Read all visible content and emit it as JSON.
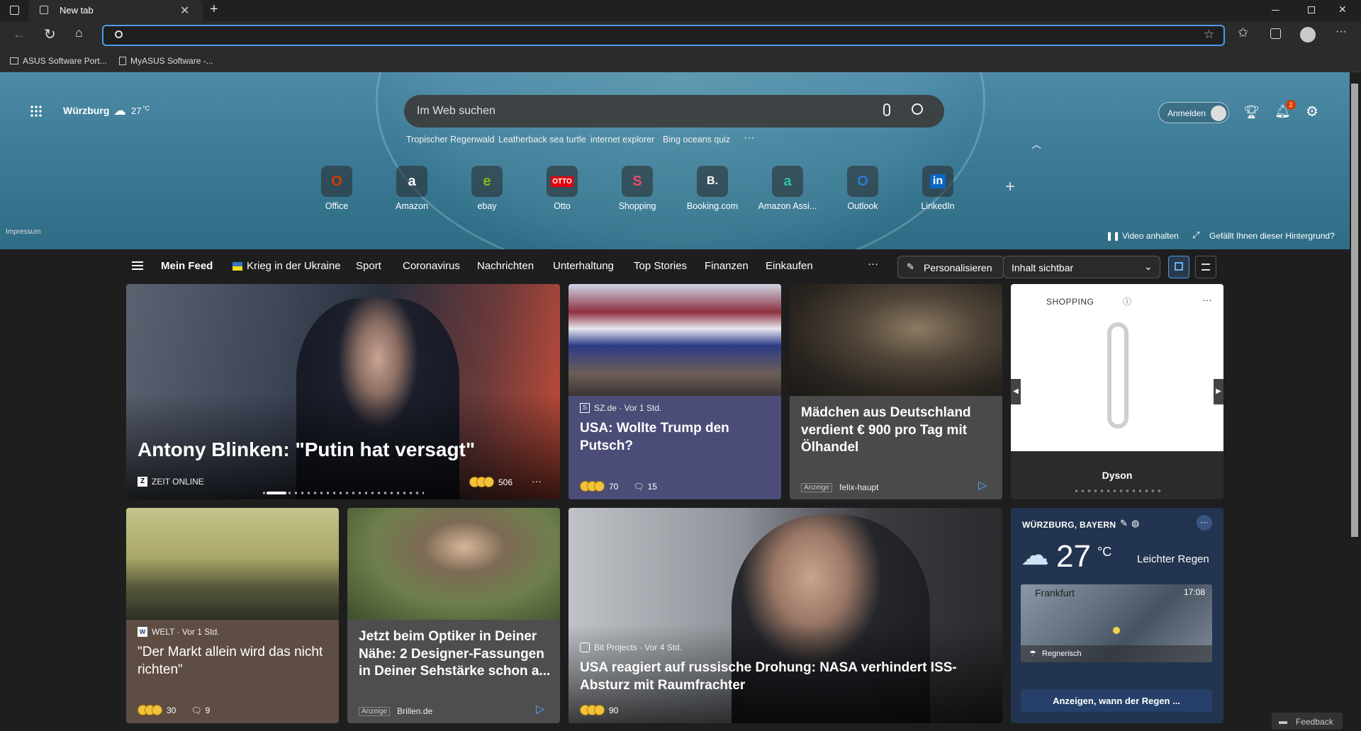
{
  "browser": {
    "tab_title": "New tab",
    "address_value": "",
    "bookmarks": [
      "ASUS Software Port...",
      "MyASUS Software -..."
    ]
  },
  "hero": {
    "location": "Würzburg",
    "temp": "27",
    "temp_unit": "°C",
    "search_placeholder": "Im Web suchen",
    "suggestions": [
      "Tropischer Regenwald",
      "Leatherback sea turtle",
      "internet explorer",
      "Bing oceans quiz"
    ],
    "signin": "Anmelden",
    "notif_count": "2",
    "impressum": "Impressum",
    "video_pause": "Video anhalten",
    "bg_like": "Gefällt Ihnen dieser Hintergrund?",
    "tiles": [
      {
        "label": "Office",
        "glyph": "O",
        "color": "#d83b01"
      },
      {
        "label": "Amazon",
        "glyph": "a",
        "color": "#ffffff"
      },
      {
        "label": "ebay",
        "glyph": "e",
        "color": "#86b817"
      },
      {
        "label": "Otto",
        "glyph": "OTTO",
        "color": "#e3000f"
      },
      {
        "label": "Shopping",
        "glyph": "S",
        "color": "#e84a6d"
      },
      {
        "label": "Booking.com",
        "glyph": "B.",
        "color": "#ffffff"
      },
      {
        "label": "Amazon Assi...",
        "glyph": "a",
        "color": "#2ec29b"
      },
      {
        "label": "Outlook",
        "glyph": "O",
        "color": "#2c7ad6"
      },
      {
        "label": "LinkedIn",
        "glyph": "in",
        "color": "#ffffff"
      }
    ]
  },
  "nav": {
    "items": [
      "Mein Feed",
      "Krieg in der Ukraine",
      "Sport",
      "Coronavirus",
      "Nachrichten",
      "Unterhaltung",
      "Top Stories",
      "Finanzen",
      "Einkaufen"
    ],
    "more": "···",
    "personalize": "Personalisieren",
    "content_select": "Inhalt sichtbar"
  },
  "cards": {
    "blinken": {
      "headline": "Antony Blinken: \"Putin hat versagt\"",
      "source": "ZEIT ONLINE",
      "reactions": "506"
    },
    "trump": {
      "source": "SZ.de · Vor 1 Std.",
      "headline": "USA: Wollte Trump den Putsch?",
      "reactions": "70",
      "comments": "15"
    },
    "oil": {
      "headline": "Mädchen aus Deutschland verdient € 900 pro Tag mit Ölhandel",
      "ad": "Anzeige",
      "source": "felix-haupt"
    },
    "shopping": {
      "title": "SHOPPING",
      "product": "Dyson"
    },
    "welt": {
      "source": "WELT · Vor 1 Std.",
      "headline": "\"Der Markt allein wird das nicht richten\"",
      "reactions": "30",
      "comments": "9"
    },
    "optiker": {
      "headline": "Jetzt beim Optiker in Deiner Nähe: 2 Designer-Fassungen in Deiner Sehstärke schon a...",
      "ad": "Anzeige",
      "source": "Brillen.de"
    },
    "nasa": {
      "source": "Bit Projects · Vor 4 Std.",
      "headline": "USA reagiert auf russische Drohung: NASA verhindert ISS-Absturz mit Raumfrachter",
      "reactions": "90"
    },
    "weather": {
      "location": "WÜRZBURG, BAYERN",
      "temp": "27",
      "unit": "°C",
      "condition": "Leichter Regen",
      "map_city": "Frankfurt",
      "map_time": "17:08",
      "map_chip": "Regnerisch",
      "cta": "Anzeigen, wann der Regen ..."
    }
  },
  "feedback": "Feedback"
}
